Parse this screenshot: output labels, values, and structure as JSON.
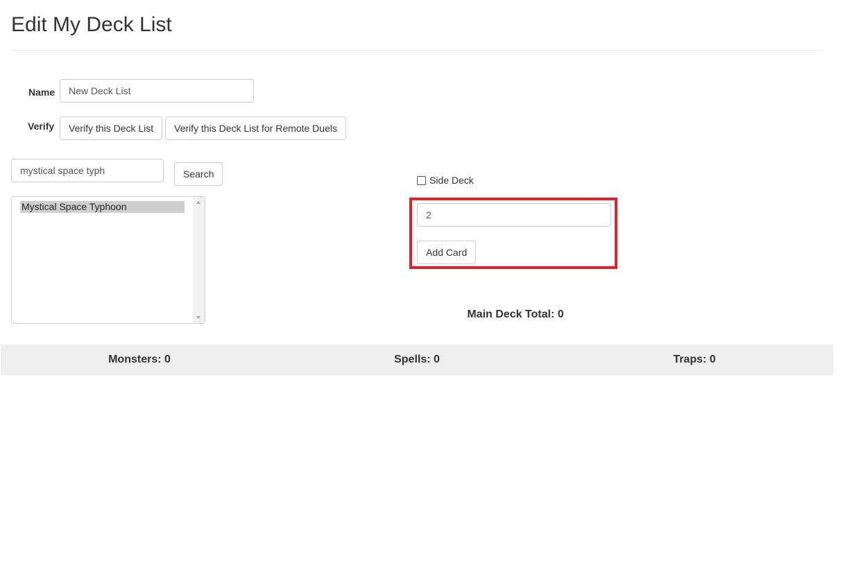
{
  "page": {
    "title": "Edit My Deck List"
  },
  "deck_form": {
    "name_label": "Name",
    "name_value": "New Deck List",
    "verify_label": "Verify",
    "verify_button": "Verify this Deck List",
    "verify_remote_button": "Verify this Deck List for Remote Duels"
  },
  "search": {
    "value": "mystical space typh",
    "button": "Search"
  },
  "results": {
    "items": [
      "Mystical Space Typhoon"
    ]
  },
  "add_panel": {
    "side_deck_label": "Side Deck",
    "side_deck_checked": false,
    "quantity_value": "2",
    "add_button": "Add Card",
    "highlight_color": "#e0202a"
  },
  "totals": {
    "main_deck": "Main Deck Total: 0",
    "monsters": "Monsters: 0",
    "spells": "Spells: 0",
    "traps": "Traps: 0"
  }
}
